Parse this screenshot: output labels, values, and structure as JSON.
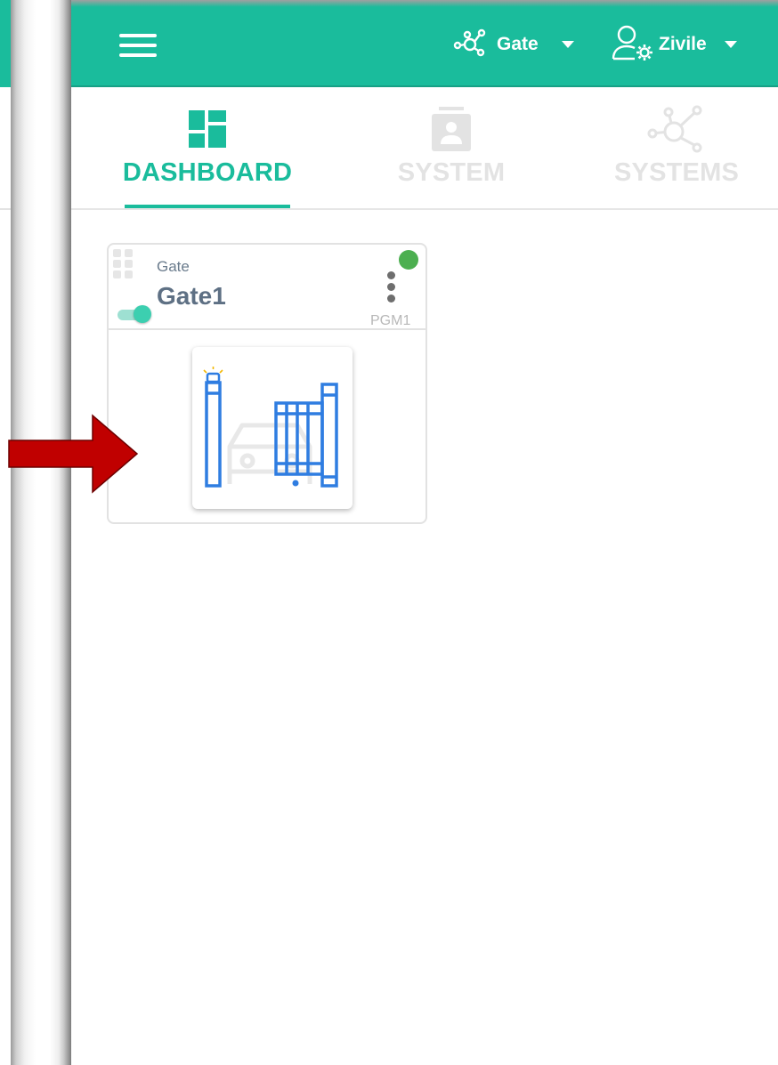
{
  "header": {
    "menu_icon": "hamburger-icon",
    "system": {
      "icon": "network-icon",
      "label": "Gate"
    },
    "user": {
      "icon": "user-settings-icon",
      "label": "Zivile"
    }
  },
  "tabs": [
    {
      "label": "DASHBOARD",
      "icon": "dashboard-icon",
      "active": true
    },
    {
      "label": "SYSTEM",
      "icon": "system-card-icon",
      "active": false
    },
    {
      "label": "SYSTEMS",
      "icon": "network-icon",
      "active": false
    }
  ],
  "card": {
    "type": "Gate",
    "name": "Gate1",
    "output": "PGM1",
    "status_color": "#4caf50",
    "toggle_on": true
  },
  "colors": {
    "accent": "#1abc9c",
    "gate_blue": "#2f7de1",
    "annotation_red": "#c00000"
  }
}
